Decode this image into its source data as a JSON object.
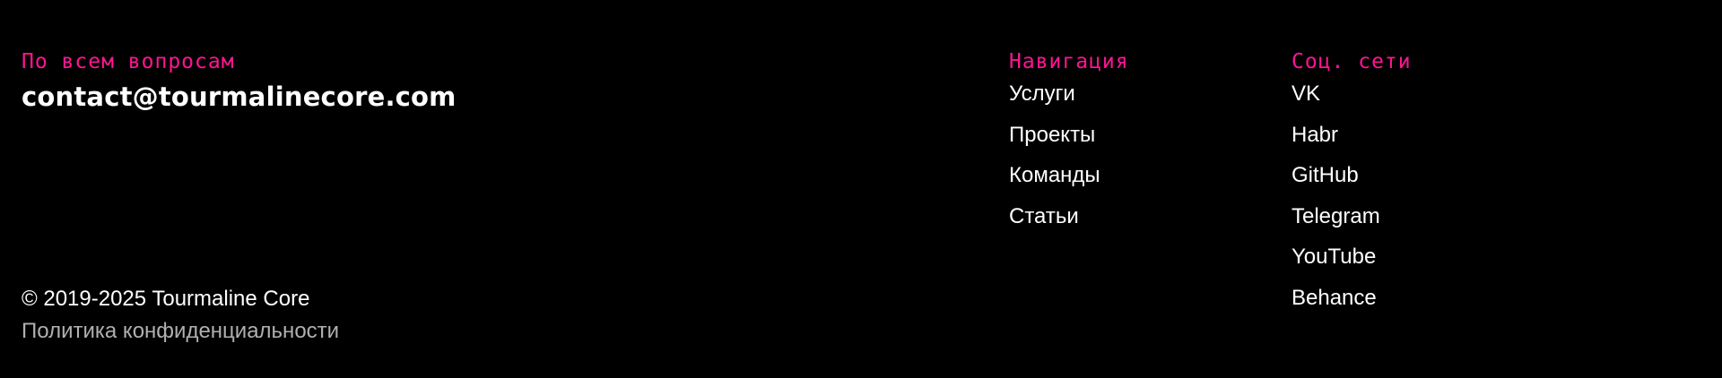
{
  "colors": {
    "background": "#000000",
    "accent": "#ff1493",
    "text": "#ffffff",
    "muted": "#b0b0b0"
  },
  "contact": {
    "label": "По всем вопросам",
    "email": "contact@tourmalinecore.com"
  },
  "navigation": {
    "title": "Навигация",
    "items": [
      {
        "label": "Услуги"
      },
      {
        "label": "Проекты"
      },
      {
        "label": "Команды"
      },
      {
        "label": "Статьи"
      }
    ]
  },
  "social": {
    "title": "Соц. сети",
    "items": [
      {
        "label": "VK"
      },
      {
        "label": "Habr"
      },
      {
        "label": "GitHub"
      },
      {
        "label": "Telegram"
      },
      {
        "label": "YouTube"
      },
      {
        "label": "Behance"
      }
    ]
  },
  "legal": {
    "copyright": "© 2019-2025 Tourmaline Core",
    "privacy": "Политика конфиденциальности"
  }
}
